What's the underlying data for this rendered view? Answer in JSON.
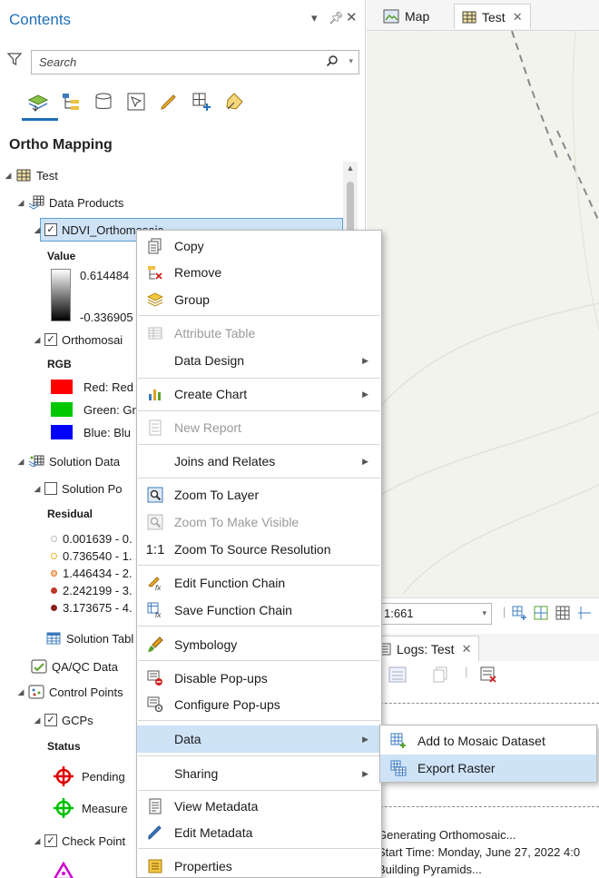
{
  "pane": {
    "title": "Contents",
    "search_placeholder": "Search",
    "heading": "Ortho Mapping"
  },
  "tree": {
    "test": "Test",
    "data_products": "Data Products",
    "ndvi": "NDVI_Orthomosaic",
    "value_label": "Value",
    "value_high": "0.614484",
    "value_low": "-0.336905",
    "orthomosaic": "Orthomosai",
    "rgb": "RGB",
    "red": "Red:  Red",
    "green": "Green: Gr",
    "blue": "Blue:  Blu",
    "solution_data": "Solution Data",
    "solution_points": "Solution Po",
    "residual": "Residual",
    "residual_classes": [
      "0.001639 - 0.",
      "0.736540 - 1.",
      "1.446434 - 2.",
      "2.242199 - 3.",
      "3.173675 - 4."
    ],
    "solution_table": "Solution Tabl",
    "qaqc": "QA/QC Data",
    "control_points": "Control Points",
    "gcps": "GCPs",
    "status": "Status",
    "pending": "Pending",
    "measured": "Measure",
    "check_points": "Check Point"
  },
  "map": {
    "tab_map": "Map",
    "tab_test": "Test",
    "scale": "1:661",
    "logs_tab": "Logs: Test",
    "log_lines": [
      "Generating Orthomosaic...",
      "Start Time: Monday, June 27, 2022 4:0",
      "Building Pyramids..."
    ]
  },
  "context_menu": {
    "copy": "Copy",
    "remove": "Remove",
    "group": "Group",
    "attribute_table": "Attribute Table",
    "data_design": "Data Design",
    "create_chart": "Create Chart",
    "new_report": "New Report",
    "joins_relates": "Joins and Relates",
    "zoom_to_layer": "Zoom To Layer",
    "zoom_visible": "Zoom To Make Visible",
    "zoom_source_icon": "1:1",
    "zoom_source": "Zoom To Source Resolution",
    "edit_function_chain": "Edit Function Chain",
    "save_function_chain": "Save Function Chain",
    "symbology": "Symbology",
    "disable_popups": "Disable Pop-ups",
    "configure_popups": "Configure Pop-ups",
    "data": "Data",
    "sharing": "Sharing",
    "view_metadata": "View Metadata",
    "edit_metadata": "Edit Metadata",
    "properties": "Properties"
  },
  "submenu": {
    "add_to_mosaic": "Add to Mosaic Dataset",
    "export_raster": "Export Raster"
  },
  "colors": {
    "accent": "#1f6fb8",
    "highlight": "#cfe3f7",
    "red": "#ff0000",
    "green": "#00c800",
    "blue": "#0000ff"
  }
}
